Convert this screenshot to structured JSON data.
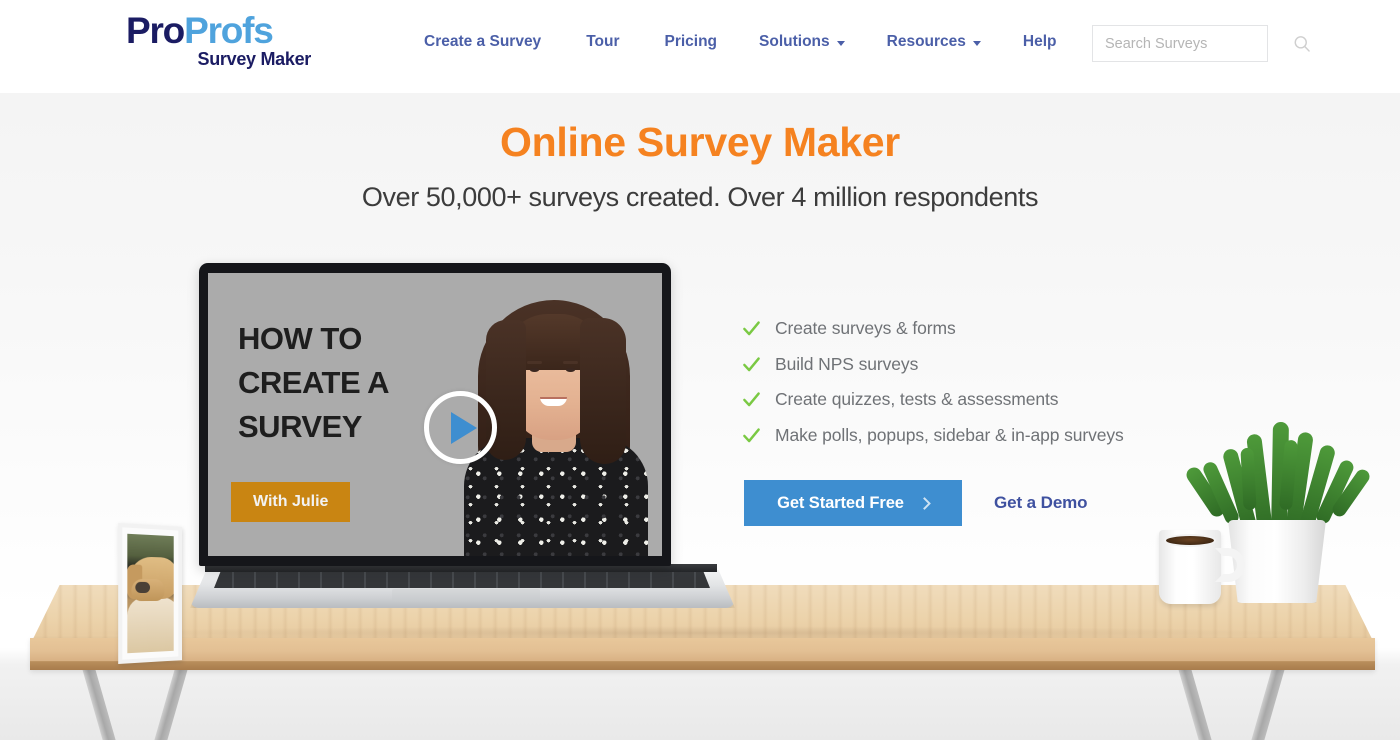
{
  "header": {
    "logo": {
      "part1": "Pro",
      "part2": "Profs",
      "tagline": "Survey Maker"
    },
    "nav": [
      {
        "label": "Create a Survey",
        "has_caret": false
      },
      {
        "label": "Tour",
        "has_caret": false
      },
      {
        "label": "Pricing",
        "has_caret": false
      },
      {
        "label": "Solutions",
        "has_caret": true
      },
      {
        "label": "Resources",
        "has_caret": true
      },
      {
        "label": "Help",
        "has_caret": false
      }
    ],
    "search": {
      "placeholder": "Search Surveys",
      "value": "",
      "icon": "search-icon"
    }
  },
  "hero": {
    "title": "Online Survey Maker",
    "subtitle": "Over 50,000+ surveys created. Over 4 million respondents",
    "features": [
      "Create surveys & forms",
      "Build NPS surveys",
      "Create quizzes, tests & assessments",
      "Make polls, popups, sidebar & in-app surveys"
    ],
    "primary_cta": "Get Started Free",
    "secondary_cta": "Get a Demo"
  },
  "video": {
    "title_line1": "HOW TO",
    "title_line2": "CREATE A",
    "title_line3": "SURVEY",
    "badge": "With Julie",
    "play_icon": "play-icon"
  },
  "colors": {
    "accent_orange": "#f58220",
    "nav_blue": "#4b5fa8",
    "cta_blue": "#3e8ed0",
    "check_green": "#7ac943",
    "badge_gold": "#c98512",
    "logo_navy": "#1b1c63",
    "logo_lightblue": "#4fa3dd"
  }
}
